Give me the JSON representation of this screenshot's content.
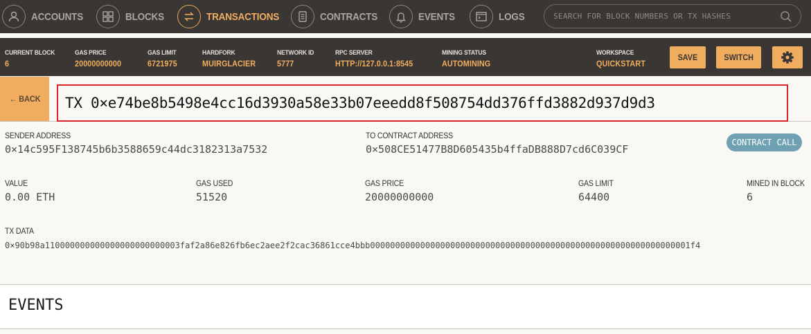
{
  "nav": {
    "items": [
      {
        "label": "ACCOUNTS",
        "icon": "account-icon"
      },
      {
        "label": "BLOCKS",
        "icon": "blocks-icon"
      },
      {
        "label": "TRANSACTIONS",
        "icon": "transactions-icon"
      },
      {
        "label": "CONTRACTS",
        "icon": "contracts-icon"
      },
      {
        "label": "EVENTS",
        "icon": "bell-icon"
      },
      {
        "label": "LOGS",
        "icon": "logs-icon"
      }
    ],
    "active": "TRANSACTIONS",
    "search_placeholder": "SEARCH FOR BLOCK NUMBERS OR TX HASHES"
  },
  "status": {
    "current_block": {
      "label": "CURRENT BLOCK",
      "value": "6"
    },
    "gas_price": {
      "label": "GAS PRICE",
      "value": "20000000000"
    },
    "gas_limit": {
      "label": "GAS LIMIT",
      "value": "6721975"
    },
    "hardfork": {
      "label": "HARDFORK",
      "value": "MUIRGLACIER"
    },
    "network_id": {
      "label": "NETWORK ID",
      "value": "5777"
    },
    "rpc_server": {
      "label": "RPC SERVER",
      "value": "HTTP://127.0.0.1:8545"
    },
    "mining_status": {
      "label": "MINING STATUS",
      "value": "AUTOMINING"
    },
    "workspace": {
      "label": "WORKSPACE",
      "value": "QUICKSTART"
    },
    "save_label": "SAVE",
    "switch_label": "SWITCH"
  },
  "tx": {
    "back_label": "← BACK",
    "title": "TX 0×e74be8b5498e4cc16d3930a58e33b07eeedd8f508754dd376ffd3882d937d9d3",
    "sender": {
      "label": "SENDER ADDRESS",
      "value": "0×14c595F138745b6b3588659c44dc3182313a7532"
    },
    "to_contract": {
      "label": "TO CONTRACT ADDRESS",
      "value": "0×508CE51477B8D605435b4ffaDB888D7cd6C039CF"
    },
    "badge": "CONTRACT CALL",
    "value": {
      "label": "VALUE",
      "value": "0.00 ETH"
    },
    "gas_used": {
      "label": "GAS USED",
      "value": "51520"
    },
    "gas_price": {
      "label": "GAS PRICE",
      "value": "20000000000"
    },
    "gas_limit": {
      "label": "GAS LIMIT",
      "value": "64400"
    },
    "mined_in_block": {
      "label": "MINED IN BLOCK",
      "value": "6"
    },
    "tx_data": {
      "label": "TX DATA",
      "value": "0×90b98a110000000000000000000000003faf2a86e826fb6ec2aee2f2cac36861cce4bbb0000000000000000000000000000000000000000000000000000000000000001f4"
    }
  },
  "events": {
    "title": "EVENTS"
  },
  "colors": {
    "accent": "#f0ad5f",
    "nav_bg": "#3a3633",
    "badge": "#6fa1b3",
    "highlight_border": "#d9242a"
  }
}
